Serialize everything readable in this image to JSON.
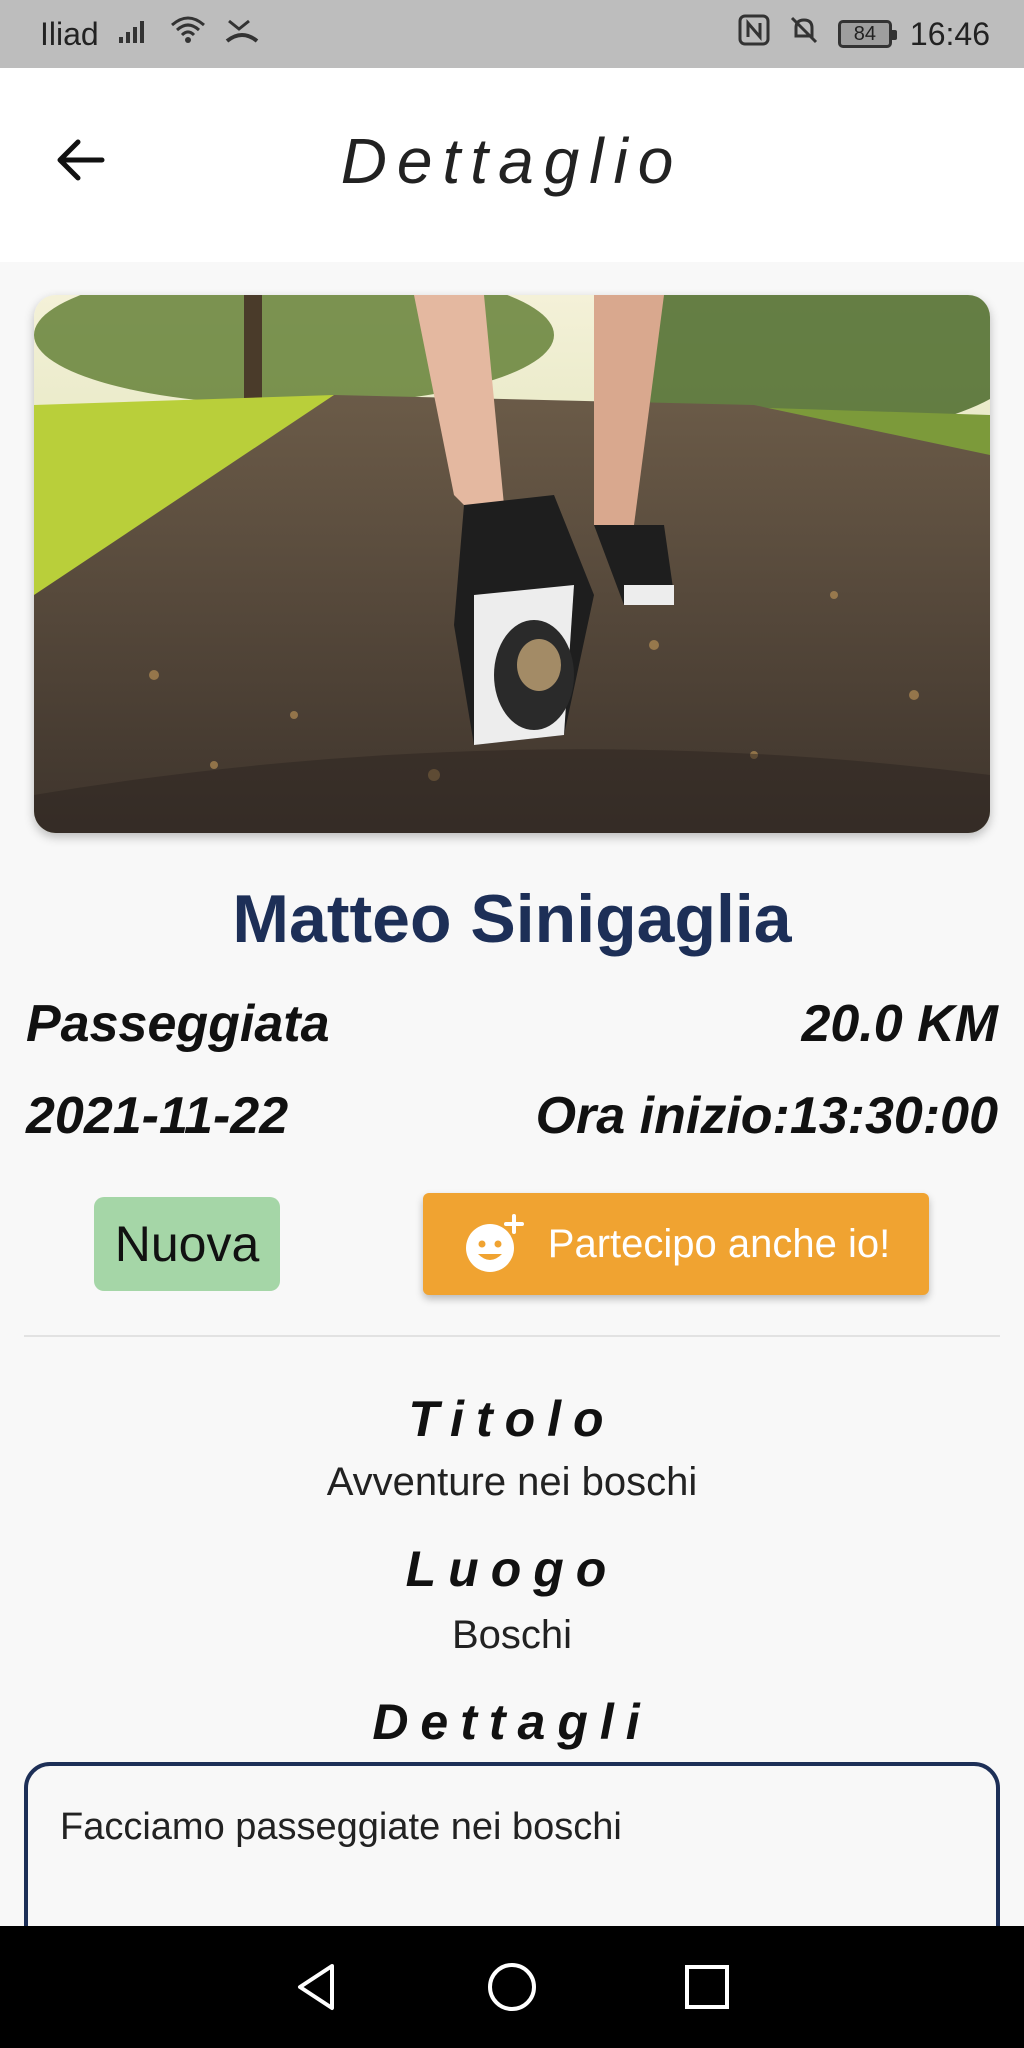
{
  "status_bar": {
    "carrier": "Iliad",
    "battery": "84",
    "time": "16:46"
  },
  "app_bar": {
    "title": "Dettaglio"
  },
  "event": {
    "organizer": "Matteo Sinigaglia",
    "type": "Passeggiata",
    "distance": "20.0 KM",
    "date": "2021-11-22",
    "start_time": "Ora inizio:13:30:00",
    "status": "Nuova",
    "join_label": "Partecipo anche io!"
  },
  "sections": {
    "title_label": "Titolo",
    "title_value": "Avventure nei boschi",
    "place_label": "Luogo",
    "place_value": "Boschi",
    "details_label": "Dettagli",
    "details_value": "Facciamo passeggiate nei boschi"
  },
  "colors": {
    "accent": "#f0a331",
    "name": "#1d2f57",
    "badge": "#a5d6a7"
  },
  "icons": {
    "back": "arrow-left-icon",
    "join": "add-emoji-icon",
    "nav_back": "triangle-back-icon",
    "nav_home": "circle-home-icon",
    "nav_recent": "square-recent-icon"
  }
}
